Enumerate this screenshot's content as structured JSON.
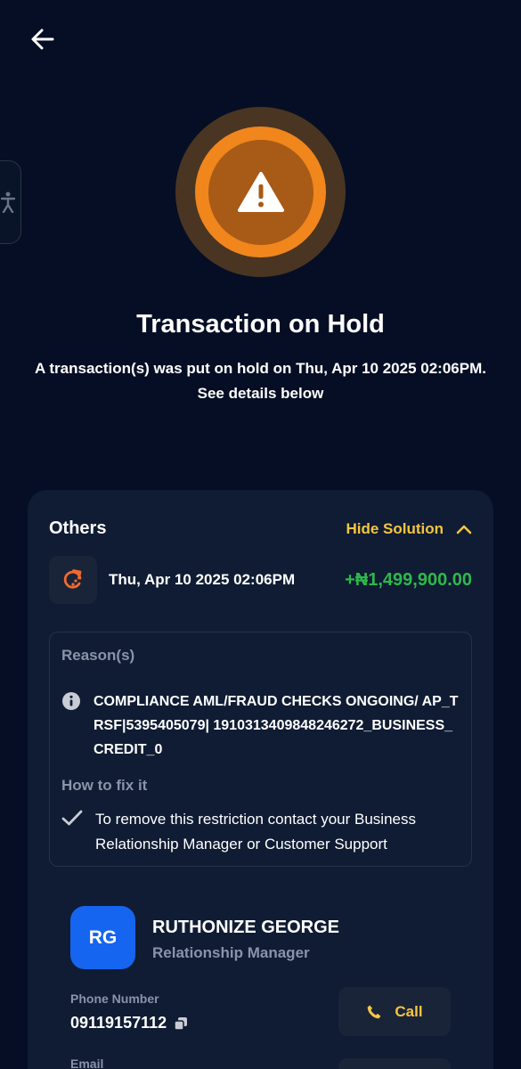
{
  "header": {
    "back_icon": "arrow-left-icon"
  },
  "side_tab": {
    "icon": "accessibility-icon"
  },
  "hero": {
    "icon": "warning-icon",
    "colors": {
      "outer": "#4a3522",
      "mid": "#f0861c",
      "inner": "#a85a17"
    }
  },
  "title": "Transaction on Hold",
  "subtitle_line1": "A transaction(s) was put on hold on Thu, Apr 10 2025 02:06PM.",
  "subtitle_line2": "See details below",
  "card": {
    "heading": "Others",
    "toggle_label": "Hide Solution",
    "toggle_icon": "chevron-up-icon",
    "transaction": {
      "icon": "refresh-icon",
      "date": "Thu, Apr 10 2025 02:06PM",
      "amount": "+₦1,499,900.00"
    },
    "reasons": {
      "label": "Reason(s)",
      "icon": "info-icon",
      "text": "COMPLIANCE AML/FRAUD CHECKS ONGOING/ AP_TRSF|5395405079| 1910313409848246272_BUSINESS_CREDIT_0"
    },
    "fix": {
      "label": "How to fix it",
      "icon": "check-icon",
      "text": "To remove this restriction contact your Business Relationship Manager or Customer Support"
    },
    "manager": {
      "initials": "RG",
      "name": "RUTHONIZE GEORGE",
      "role": "Relationship Manager",
      "phone_label": "Phone Number",
      "phone": "09119157112",
      "copy_icon": "copy-icon",
      "call_label": "Call",
      "call_icon": "phone-icon",
      "email_label": "Email"
    }
  },
  "colors": {
    "background": "#050e24",
    "card": "#0f1c33",
    "accent": "#f5c542",
    "amount": "#2eb84b",
    "avatar": "#1565f0"
  }
}
